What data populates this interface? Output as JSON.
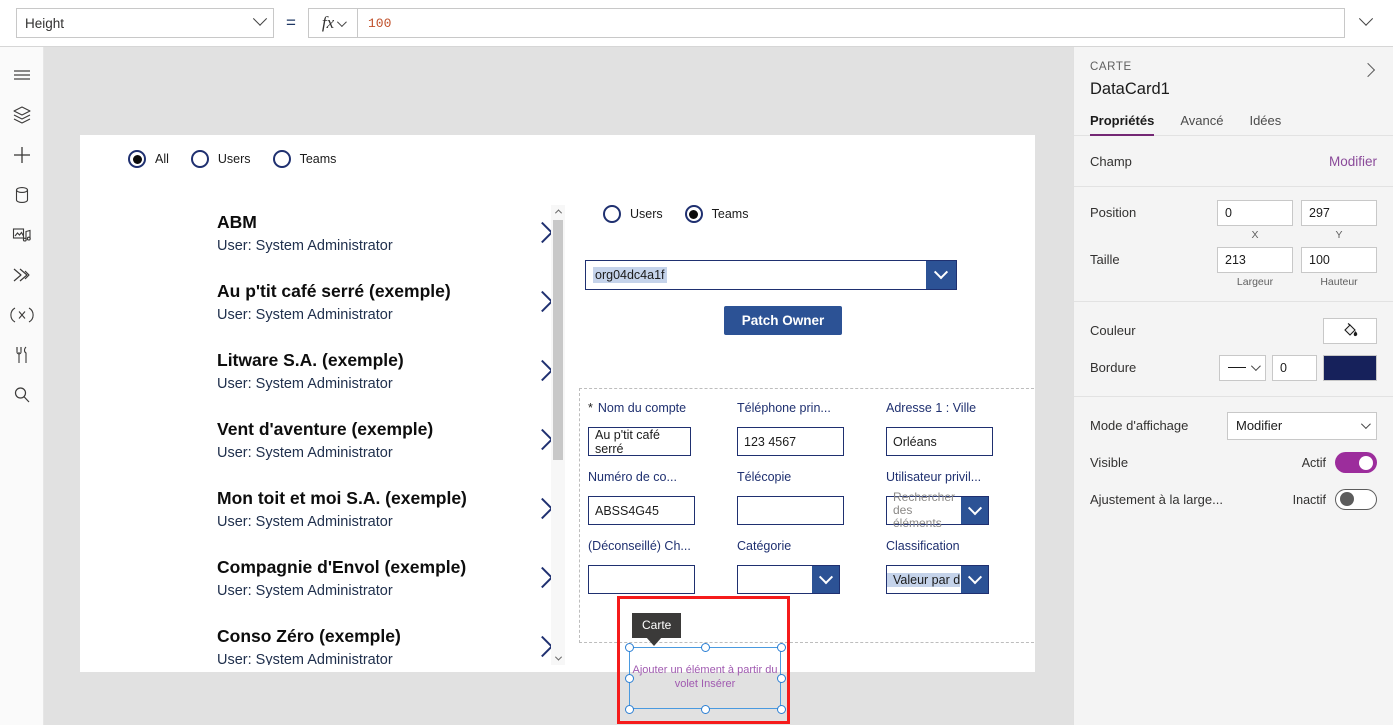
{
  "formula_bar": {
    "property": "Height",
    "equals": "=",
    "fx_label": "fx",
    "value": "100"
  },
  "left_rail": [
    {
      "name": "hamburger-menu-icon",
      "title": "Menu"
    },
    {
      "name": "tree-view-icon",
      "title": "Arborescence"
    },
    {
      "name": "insert-icon",
      "title": "Insérer"
    },
    {
      "name": "data-icon",
      "title": "Données"
    },
    {
      "name": "media-icon",
      "title": "Média"
    },
    {
      "name": "power-automate-icon",
      "title": "Power Automate"
    },
    {
      "name": "variables-icon",
      "title": "Variables"
    },
    {
      "name": "tools-icon",
      "title": "Outils"
    },
    {
      "name": "search-icon",
      "title": "Rechercher"
    }
  ],
  "canvas": {
    "top_radios": [
      {
        "label": "All",
        "selected": true
      },
      {
        "label": "Users",
        "selected": false
      },
      {
        "label": "Teams",
        "selected": false
      }
    ],
    "gallery": [
      {
        "title": "ABM",
        "subtitle": "User: System Administrator"
      },
      {
        "title": "Au p'tit café serré (exemple)",
        "subtitle": "User: System Administrator"
      },
      {
        "title": "Litware S.A. (exemple)",
        "subtitle": "User: System Administrator"
      },
      {
        "title": "Vent d'aventure (exemple)",
        "subtitle": "User: System Administrator"
      },
      {
        "title": "Mon toit et moi S.A. (exemple)",
        "subtitle": "User: System Administrator"
      },
      {
        "title": "Compagnie d'Envol (exemple)",
        "subtitle": "User: System Administrator"
      },
      {
        "title": "Conso Zéro (exemple)",
        "subtitle": "User: System Administrator"
      }
    ],
    "form_radios": [
      {
        "label": "Users",
        "selected": false
      },
      {
        "label": "Teams",
        "selected": true
      }
    ],
    "owner_combo_value": "org04dc4a1f",
    "patch_button": "Patch Owner",
    "fields": [
      {
        "label": "Nom du compte",
        "required": true,
        "type": "text",
        "value": "Au p'tit café serré"
      },
      {
        "label": "Téléphone prin...",
        "required": false,
        "type": "text",
        "value": "123 4567"
      },
      {
        "label": "Adresse 1 : Ville",
        "required": false,
        "type": "text",
        "value": "Orléans"
      },
      {
        "label": "Numéro de co...",
        "required": false,
        "type": "text",
        "value": "ABSS4G45"
      },
      {
        "label": "Télécopie",
        "required": false,
        "type": "text",
        "value": ""
      },
      {
        "label": "Utilisateur privil...",
        "required": false,
        "type": "lookup",
        "value": "",
        "placeholder": "Rechercher des éléments"
      },
      {
        "label": "(Déconseillé) Ch...",
        "required": false,
        "type": "text",
        "value": ""
      },
      {
        "label": "Catégorie",
        "required": false,
        "type": "combo",
        "value": ""
      },
      {
        "label": "Classification",
        "required": false,
        "type": "combo",
        "value": "Valeur par dé",
        "selected_text": true
      }
    ],
    "selection": {
      "tooltip": "Carte",
      "empty_card_placeholder": "Ajouter un élément à partir du volet Insérer",
      "highlight_color": "#f51b1b",
      "handle_color": "#2a7fd4"
    }
  },
  "properties_panel": {
    "kicker": "CARTE",
    "title": "DataCard1",
    "tabs": [
      {
        "label": "Propriétés",
        "active": true
      },
      {
        "label": "Avancé",
        "active": false
      },
      {
        "label": "Idées",
        "active": false
      }
    ],
    "field_row": {
      "label": "Champ",
      "action": "Modifier"
    },
    "position": {
      "label": "Position",
      "x": "0",
      "y": "297",
      "x_caption": "X",
      "y_caption": "Y"
    },
    "size": {
      "label": "Taille",
      "width": "213",
      "height": "100",
      "width_caption": "Largeur",
      "height_caption": "Hauteur"
    },
    "color": {
      "label": "Couleur",
      "icon": "paint-bucket-icon"
    },
    "border": {
      "label": "Bordure",
      "width": "0",
      "color": "#16215b"
    },
    "display_mode": {
      "label": "Mode d'affichage",
      "value": "Modifier"
    },
    "visible": {
      "label": "Visible",
      "state": "Actif",
      "on": true
    },
    "auto_width": {
      "label": "Ajustement à la large...",
      "state": "Inactif",
      "on": false
    }
  }
}
